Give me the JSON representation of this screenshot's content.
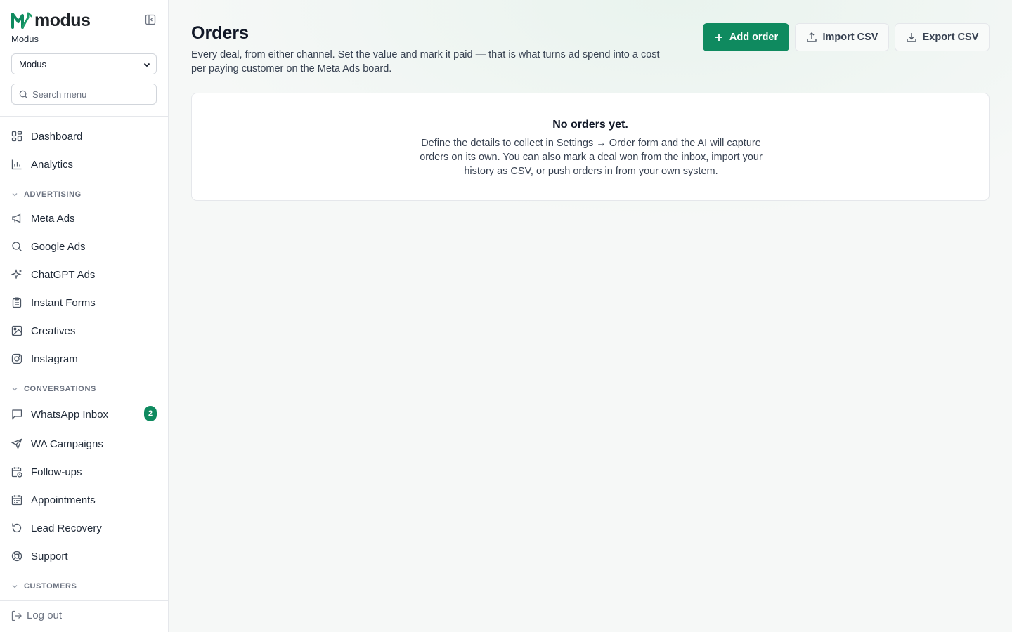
{
  "brand": {
    "name": "modus",
    "org_label": "Modus"
  },
  "sidebar": {
    "org_select_value": "Modus",
    "search_placeholder": "Search menu",
    "top_items": [
      {
        "label": "Dashboard",
        "icon": "dashboard-icon"
      },
      {
        "label": "Analytics",
        "icon": "bar-chart-icon"
      }
    ],
    "sections": [
      {
        "label": "ADVERTISING",
        "items": [
          {
            "label": "Meta Ads",
            "icon": "megaphone-icon"
          },
          {
            "label": "Google Ads",
            "icon": "search-icon"
          },
          {
            "label": "ChatGPT Ads",
            "icon": "sparkles-icon"
          },
          {
            "label": "Instant Forms",
            "icon": "clipboard-icon"
          },
          {
            "label": "Creatives",
            "icon": "image-icon"
          },
          {
            "label": "Instagram",
            "icon": "instagram-icon"
          }
        ]
      },
      {
        "label": "CONVERSATIONS",
        "items": [
          {
            "label": "WhatsApp Inbox",
            "icon": "chat-bubble-icon",
            "badge": "2"
          },
          {
            "label": "WA Campaigns",
            "icon": "send-icon"
          },
          {
            "label": "Follow-ups",
            "icon": "calendar-clock-icon"
          },
          {
            "label": "Appointments",
            "icon": "calendar-icon"
          },
          {
            "label": "Lead Recovery",
            "icon": "rotate-ccw-icon"
          },
          {
            "label": "Support",
            "icon": "life-buoy-icon"
          }
        ]
      },
      {
        "label": "CUSTOMERS",
        "items": []
      }
    ],
    "logout_label": "Log out"
  },
  "page": {
    "title": "Orders",
    "subtitle": "Every deal, from either channel. Set the value and mark it paid — that is what turns ad spend into a cost per paying customer on the Meta Ads board.",
    "actions": {
      "add": "Add order",
      "import": "Import CSV",
      "export": "Export CSV"
    },
    "empty": {
      "title": "No orders yet.",
      "description": "Define the details to collect in Settings → Order form and the AI will capture orders on its own. You can also mark a deal won from the inbox, import your history as CSV, or push orders in from your own system."
    }
  },
  "colors": {
    "accent": "#0f8a5f",
    "background": "#f6f8f7",
    "sidebar": "#ffffff"
  }
}
